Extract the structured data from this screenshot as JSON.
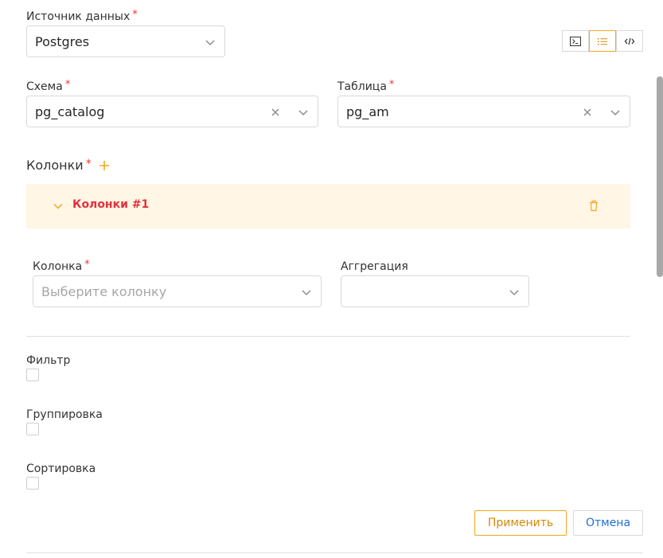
{
  "datasource": {
    "label": "Источник данных",
    "value": "Postgres"
  },
  "view_modes": [
    {
      "name": "terminal-icon",
      "active": false
    },
    {
      "name": "list-icon",
      "active": true
    },
    {
      "name": "code-icon",
      "active": false
    }
  ],
  "schema": {
    "label": "Схема",
    "value": "pg_catalog"
  },
  "table": {
    "label": "Таблица",
    "value": "pg_am"
  },
  "columns_section": {
    "label": "Колонки",
    "add_icon": "plus-icon"
  },
  "column_group": {
    "title": "Колонки #1"
  },
  "column_field": {
    "label": "Колонка",
    "placeholder": "Выберите колонку"
  },
  "aggregation_field": {
    "label": "Аггрегация",
    "value": ""
  },
  "filter": {
    "label": "Фильтр",
    "checked": false
  },
  "grouping": {
    "label": "Группировка",
    "checked": false
  },
  "sorting": {
    "label": "Сортировка",
    "checked": false
  },
  "actions": {
    "apply_label": "Применить",
    "cancel_label": "Отмена"
  },
  "colors": {
    "accent": "#f5a623",
    "required": "#e53935",
    "panel_bg": "#fff6e5",
    "panel_title": "#e5303c",
    "link": "#1e6fd9"
  }
}
